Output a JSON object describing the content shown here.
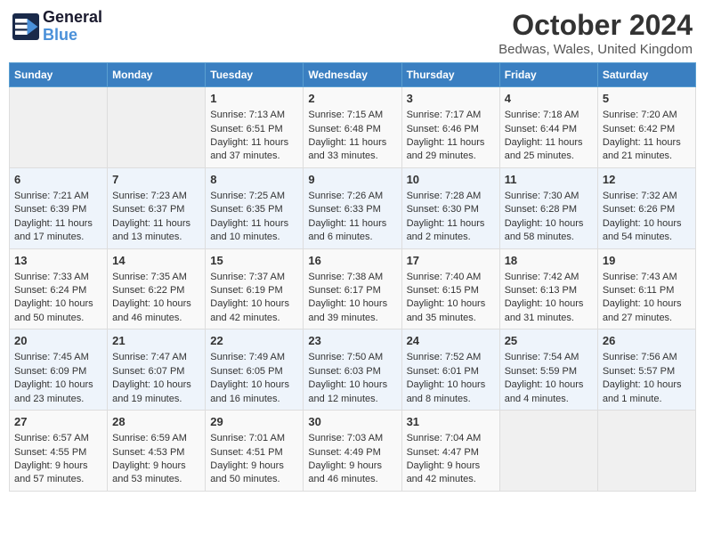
{
  "logo": {
    "line1": "General",
    "line2": "Blue"
  },
  "title": "October 2024",
  "location": "Bedwas, Wales, United Kingdom",
  "days_of_week": [
    "Sunday",
    "Monday",
    "Tuesday",
    "Wednesday",
    "Thursday",
    "Friday",
    "Saturday"
  ],
  "weeks": [
    [
      {
        "day": "",
        "sunrise": "",
        "sunset": "",
        "daylight": ""
      },
      {
        "day": "",
        "sunrise": "",
        "sunset": "",
        "daylight": ""
      },
      {
        "day": "1",
        "sunrise": "Sunrise: 7:13 AM",
        "sunset": "Sunset: 6:51 PM",
        "daylight": "Daylight: 11 hours and 37 minutes."
      },
      {
        "day": "2",
        "sunrise": "Sunrise: 7:15 AM",
        "sunset": "Sunset: 6:48 PM",
        "daylight": "Daylight: 11 hours and 33 minutes."
      },
      {
        "day": "3",
        "sunrise": "Sunrise: 7:17 AM",
        "sunset": "Sunset: 6:46 PM",
        "daylight": "Daylight: 11 hours and 29 minutes."
      },
      {
        "day": "4",
        "sunrise": "Sunrise: 7:18 AM",
        "sunset": "Sunset: 6:44 PM",
        "daylight": "Daylight: 11 hours and 25 minutes."
      },
      {
        "day": "5",
        "sunrise": "Sunrise: 7:20 AM",
        "sunset": "Sunset: 6:42 PM",
        "daylight": "Daylight: 11 hours and 21 minutes."
      }
    ],
    [
      {
        "day": "6",
        "sunrise": "Sunrise: 7:21 AM",
        "sunset": "Sunset: 6:39 PM",
        "daylight": "Daylight: 11 hours and 17 minutes."
      },
      {
        "day": "7",
        "sunrise": "Sunrise: 7:23 AM",
        "sunset": "Sunset: 6:37 PM",
        "daylight": "Daylight: 11 hours and 13 minutes."
      },
      {
        "day": "8",
        "sunrise": "Sunrise: 7:25 AM",
        "sunset": "Sunset: 6:35 PM",
        "daylight": "Daylight: 11 hours and 10 minutes."
      },
      {
        "day": "9",
        "sunrise": "Sunrise: 7:26 AM",
        "sunset": "Sunset: 6:33 PM",
        "daylight": "Daylight: 11 hours and 6 minutes."
      },
      {
        "day": "10",
        "sunrise": "Sunrise: 7:28 AM",
        "sunset": "Sunset: 6:30 PM",
        "daylight": "Daylight: 11 hours and 2 minutes."
      },
      {
        "day": "11",
        "sunrise": "Sunrise: 7:30 AM",
        "sunset": "Sunset: 6:28 PM",
        "daylight": "Daylight: 10 hours and 58 minutes."
      },
      {
        "day": "12",
        "sunrise": "Sunrise: 7:32 AM",
        "sunset": "Sunset: 6:26 PM",
        "daylight": "Daylight: 10 hours and 54 minutes."
      }
    ],
    [
      {
        "day": "13",
        "sunrise": "Sunrise: 7:33 AM",
        "sunset": "Sunset: 6:24 PM",
        "daylight": "Daylight: 10 hours and 50 minutes."
      },
      {
        "day": "14",
        "sunrise": "Sunrise: 7:35 AM",
        "sunset": "Sunset: 6:22 PM",
        "daylight": "Daylight: 10 hours and 46 minutes."
      },
      {
        "day": "15",
        "sunrise": "Sunrise: 7:37 AM",
        "sunset": "Sunset: 6:19 PM",
        "daylight": "Daylight: 10 hours and 42 minutes."
      },
      {
        "day": "16",
        "sunrise": "Sunrise: 7:38 AM",
        "sunset": "Sunset: 6:17 PM",
        "daylight": "Daylight: 10 hours and 39 minutes."
      },
      {
        "day": "17",
        "sunrise": "Sunrise: 7:40 AM",
        "sunset": "Sunset: 6:15 PM",
        "daylight": "Daylight: 10 hours and 35 minutes."
      },
      {
        "day": "18",
        "sunrise": "Sunrise: 7:42 AM",
        "sunset": "Sunset: 6:13 PM",
        "daylight": "Daylight: 10 hours and 31 minutes."
      },
      {
        "day": "19",
        "sunrise": "Sunrise: 7:43 AM",
        "sunset": "Sunset: 6:11 PM",
        "daylight": "Daylight: 10 hours and 27 minutes."
      }
    ],
    [
      {
        "day": "20",
        "sunrise": "Sunrise: 7:45 AM",
        "sunset": "Sunset: 6:09 PM",
        "daylight": "Daylight: 10 hours and 23 minutes."
      },
      {
        "day": "21",
        "sunrise": "Sunrise: 7:47 AM",
        "sunset": "Sunset: 6:07 PM",
        "daylight": "Daylight: 10 hours and 19 minutes."
      },
      {
        "day": "22",
        "sunrise": "Sunrise: 7:49 AM",
        "sunset": "Sunset: 6:05 PM",
        "daylight": "Daylight: 10 hours and 16 minutes."
      },
      {
        "day": "23",
        "sunrise": "Sunrise: 7:50 AM",
        "sunset": "Sunset: 6:03 PM",
        "daylight": "Daylight: 10 hours and 12 minutes."
      },
      {
        "day": "24",
        "sunrise": "Sunrise: 7:52 AM",
        "sunset": "Sunset: 6:01 PM",
        "daylight": "Daylight: 10 hours and 8 minutes."
      },
      {
        "day": "25",
        "sunrise": "Sunrise: 7:54 AM",
        "sunset": "Sunset: 5:59 PM",
        "daylight": "Daylight: 10 hours and 4 minutes."
      },
      {
        "day": "26",
        "sunrise": "Sunrise: 7:56 AM",
        "sunset": "Sunset: 5:57 PM",
        "daylight": "Daylight: 10 hours and 1 minute."
      }
    ],
    [
      {
        "day": "27",
        "sunrise": "Sunrise: 6:57 AM",
        "sunset": "Sunset: 4:55 PM",
        "daylight": "Daylight: 9 hours and 57 minutes."
      },
      {
        "day": "28",
        "sunrise": "Sunrise: 6:59 AM",
        "sunset": "Sunset: 4:53 PM",
        "daylight": "Daylight: 9 hours and 53 minutes."
      },
      {
        "day": "29",
        "sunrise": "Sunrise: 7:01 AM",
        "sunset": "Sunset: 4:51 PM",
        "daylight": "Daylight: 9 hours and 50 minutes."
      },
      {
        "day": "30",
        "sunrise": "Sunrise: 7:03 AM",
        "sunset": "Sunset: 4:49 PM",
        "daylight": "Daylight: 9 hours and 46 minutes."
      },
      {
        "day": "31",
        "sunrise": "Sunrise: 7:04 AM",
        "sunset": "Sunset: 4:47 PM",
        "daylight": "Daylight: 9 hours and 42 minutes."
      },
      {
        "day": "",
        "sunrise": "",
        "sunset": "",
        "daylight": ""
      },
      {
        "day": "",
        "sunrise": "",
        "sunset": "",
        "daylight": ""
      }
    ]
  ]
}
